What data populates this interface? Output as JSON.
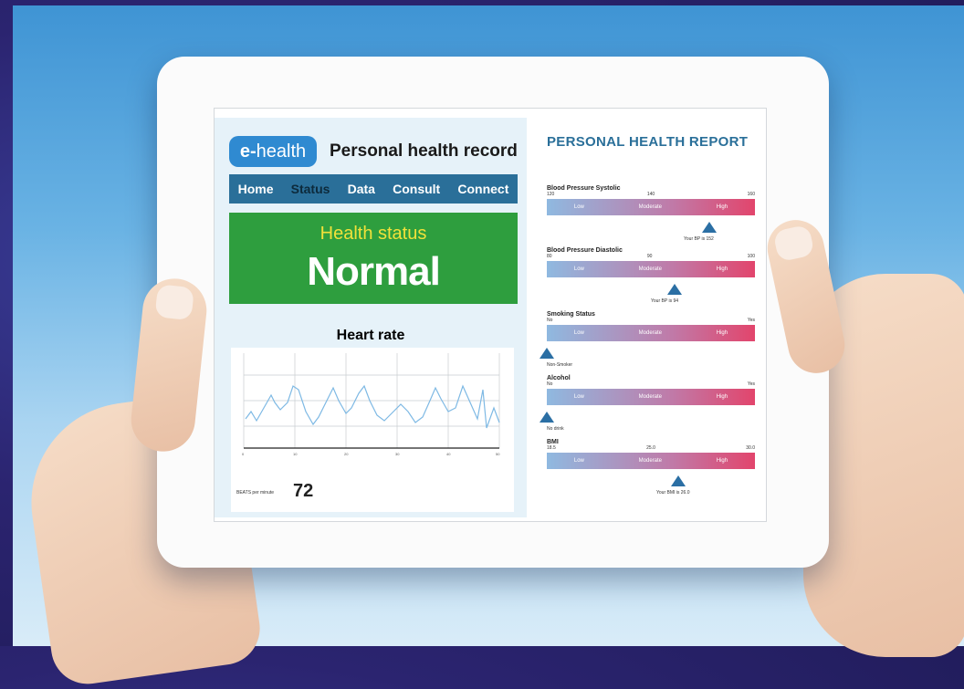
{
  "app": {
    "logo_prefix": "e-",
    "logo_name": "health",
    "title": "Personal health record",
    "nav": [
      "Home",
      "Status",
      "Data",
      "Consult",
      "Connect"
    ],
    "active_nav": "Status",
    "status_label": "Health status",
    "status_value": "Normal",
    "heart_rate_title": "Heart rate",
    "bpm_label": "BEATS per minute",
    "bpm_value": "72"
  },
  "report": {
    "title": "PERSONAL HEALTH REPORT",
    "levels": [
      "Low",
      "Moderate",
      "High"
    ],
    "metrics": [
      {
        "name": "Blood Pressure Systolic",
        "ticks": [
          "120",
          "140",
          "160"
        ],
        "note": "Your BP is 152",
        "level": 0.78
      },
      {
        "name": "Blood Pressure Diastolic",
        "ticks": [
          "80",
          "90",
          "100"
        ],
        "note": "Your BP is 94",
        "level": 0.6
      },
      {
        "name": "Smoking Status",
        "ticks": [
          "No",
          "Yes"
        ],
        "note": "Non-Smoker",
        "level": 0.0
      },
      {
        "name": "Alcohol",
        "ticks": [
          "No",
          "Yes"
        ],
        "note": "No drink",
        "level": 0.0
      },
      {
        "name": "BMI",
        "ticks": [
          "18.5",
          "25.0",
          "30.0"
        ],
        "note": "Your BMI is 26.0",
        "level": 0.63
      }
    ]
  },
  "colors": {
    "nav": "#2a6f99",
    "status": "#2e9e3e",
    "status_label": "#f1e13a",
    "report_title": "#2a6f99"
  }
}
